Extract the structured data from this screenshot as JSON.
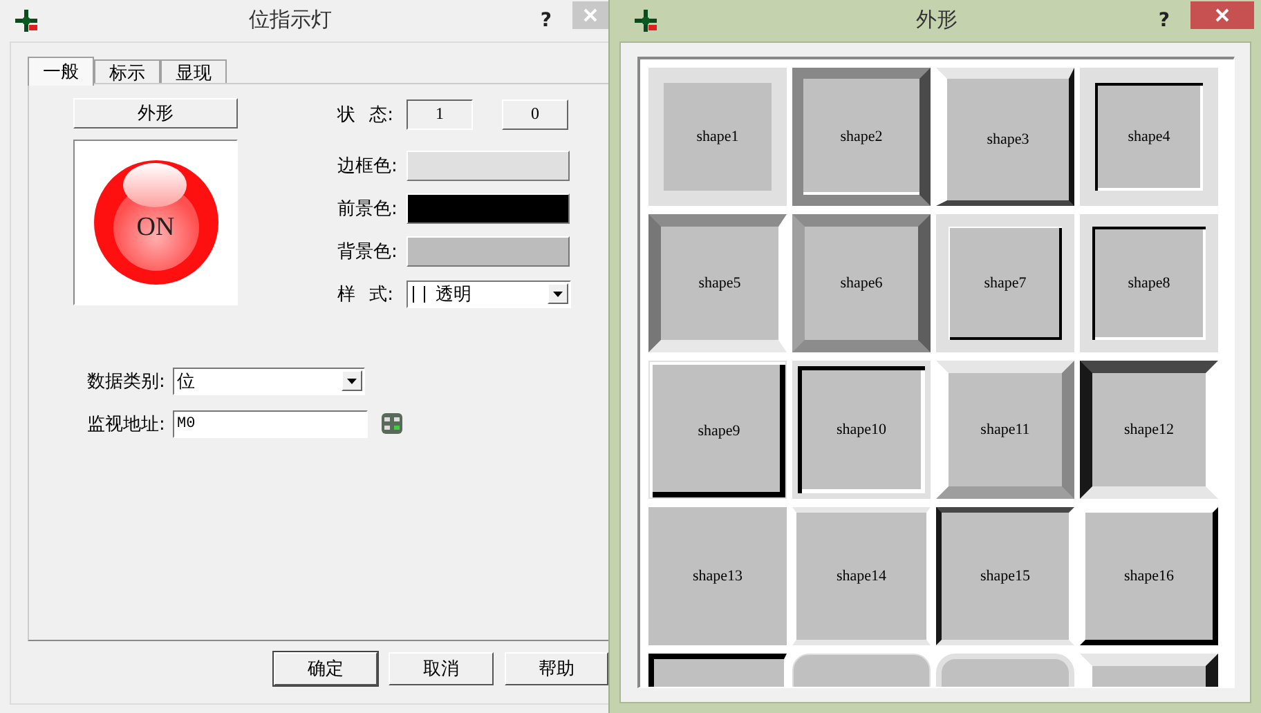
{
  "dialog": {
    "title": "位指示灯",
    "help": "?",
    "tabs": [
      {
        "label": "一般",
        "selected": true
      },
      {
        "label": "标示",
        "selected": false
      },
      {
        "label": "显现",
        "selected": false
      }
    ],
    "shape_button": "外形",
    "preview": {
      "text": "ON"
    },
    "state": {
      "label": "状 态:",
      "options": [
        {
          "label": "1",
          "selected": true
        },
        {
          "label": "0",
          "selected": false
        }
      ]
    },
    "colors": [
      {
        "label": "边框色:",
        "color": "#e0e0e0"
      },
      {
        "label": "前景色:",
        "color": "#000000"
      },
      {
        "label": "背景色:",
        "color": "#bcbcbc"
      }
    ],
    "style": {
      "label": "样 式:",
      "value": "透明"
    },
    "data_type": {
      "label": "数据类别:",
      "value": "位"
    },
    "address": {
      "label": "监视地址:",
      "value": "M0"
    },
    "buttons": [
      {
        "label": "确定",
        "default": true
      },
      {
        "label": "取消",
        "default": false
      },
      {
        "label": "帮助",
        "default": false
      }
    ]
  },
  "shape_window": {
    "title": "外形",
    "help": "?",
    "shapes": [
      {
        "label": "shape1",
        "kind": "frame"
      },
      {
        "label": "shape2",
        "kind": "raisedgrey"
      },
      {
        "label": "shape3",
        "kind": "raiseddark"
      },
      {
        "label": "shape4",
        "kind": "frameinset"
      },
      {
        "label": "shape5",
        "kind": "bevelin"
      },
      {
        "label": "shape6",
        "kind": "bevelgrey"
      },
      {
        "label": "shape7",
        "kind": "frameraised"
      },
      {
        "label": "shape8",
        "kind": "frameinset2"
      },
      {
        "label": "shape9",
        "kind": "whiteshadow"
      },
      {
        "label": "shape10",
        "kind": "framesunken"
      },
      {
        "label": "shape11",
        "kind": "bevelout"
      },
      {
        "label": "shape12",
        "kind": "beveldark"
      },
      {
        "label": "shape13",
        "kind": "flat"
      },
      {
        "label": "shape14",
        "kind": "thin"
      },
      {
        "label": "shape15",
        "kind": "topdark"
      },
      {
        "label": "shape16",
        "kind": "shadow"
      },
      {
        "kind": "sunkenblack"
      },
      {
        "kind": "round"
      },
      {
        "kind": "roundframe"
      },
      {
        "kind": "rightdark"
      }
    ]
  }
}
